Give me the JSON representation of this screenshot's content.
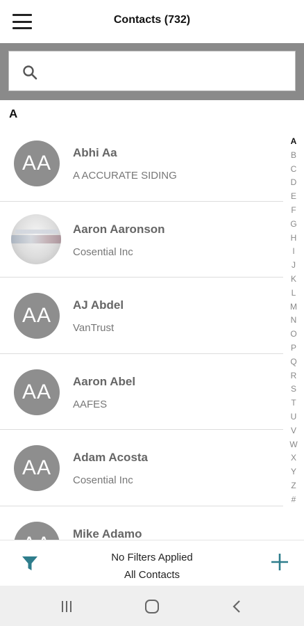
{
  "header": {
    "title": "Contacts (732)"
  },
  "search": {
    "placeholder": "",
    "value": ""
  },
  "section": {
    "letter": "A"
  },
  "contacts": [
    {
      "name": "Abhi Aa",
      "company": "A ACCURATE SIDING",
      "initials": "AA",
      "has_photo": false
    },
    {
      "name": "Aaron Aaronson",
      "company": "Cosential Inc",
      "initials": "",
      "has_photo": true
    },
    {
      "name": "AJ Abdel",
      "company": "VanTrust",
      "initials": "AA",
      "has_photo": false
    },
    {
      "name": "Aaron Abel",
      "company": "AAFES",
      "initials": "AA",
      "has_photo": false
    },
    {
      "name": "Adam Acosta",
      "company": "Cosential Inc",
      "initials": "AA",
      "has_photo": false
    },
    {
      "name": "Mike Adamo",
      "company": "",
      "initials": "AA",
      "has_photo": false
    }
  ],
  "alphabet": [
    "A",
    "B",
    "C",
    "D",
    "E",
    "F",
    "G",
    "H",
    "I",
    "J",
    "K",
    "L",
    "M",
    "N",
    "O",
    "P",
    "Q",
    "R",
    "S",
    "T",
    "U",
    "V",
    "W",
    "X",
    "Y",
    "Z",
    "#"
  ],
  "filter_bar": {
    "status_line1": "No Filters Applied",
    "status_line2": "All Contacts"
  },
  "colors": {
    "accent": "#2e7d8c",
    "avatar_bg": "#8e8e8e",
    "search_frame": "#8a8a8a"
  },
  "icons": {
    "menu": "hamburger-icon",
    "search": "search-icon",
    "filter": "filter-icon",
    "add": "plus-icon",
    "recents": "recents-icon",
    "home": "home-icon",
    "back": "back-icon"
  }
}
